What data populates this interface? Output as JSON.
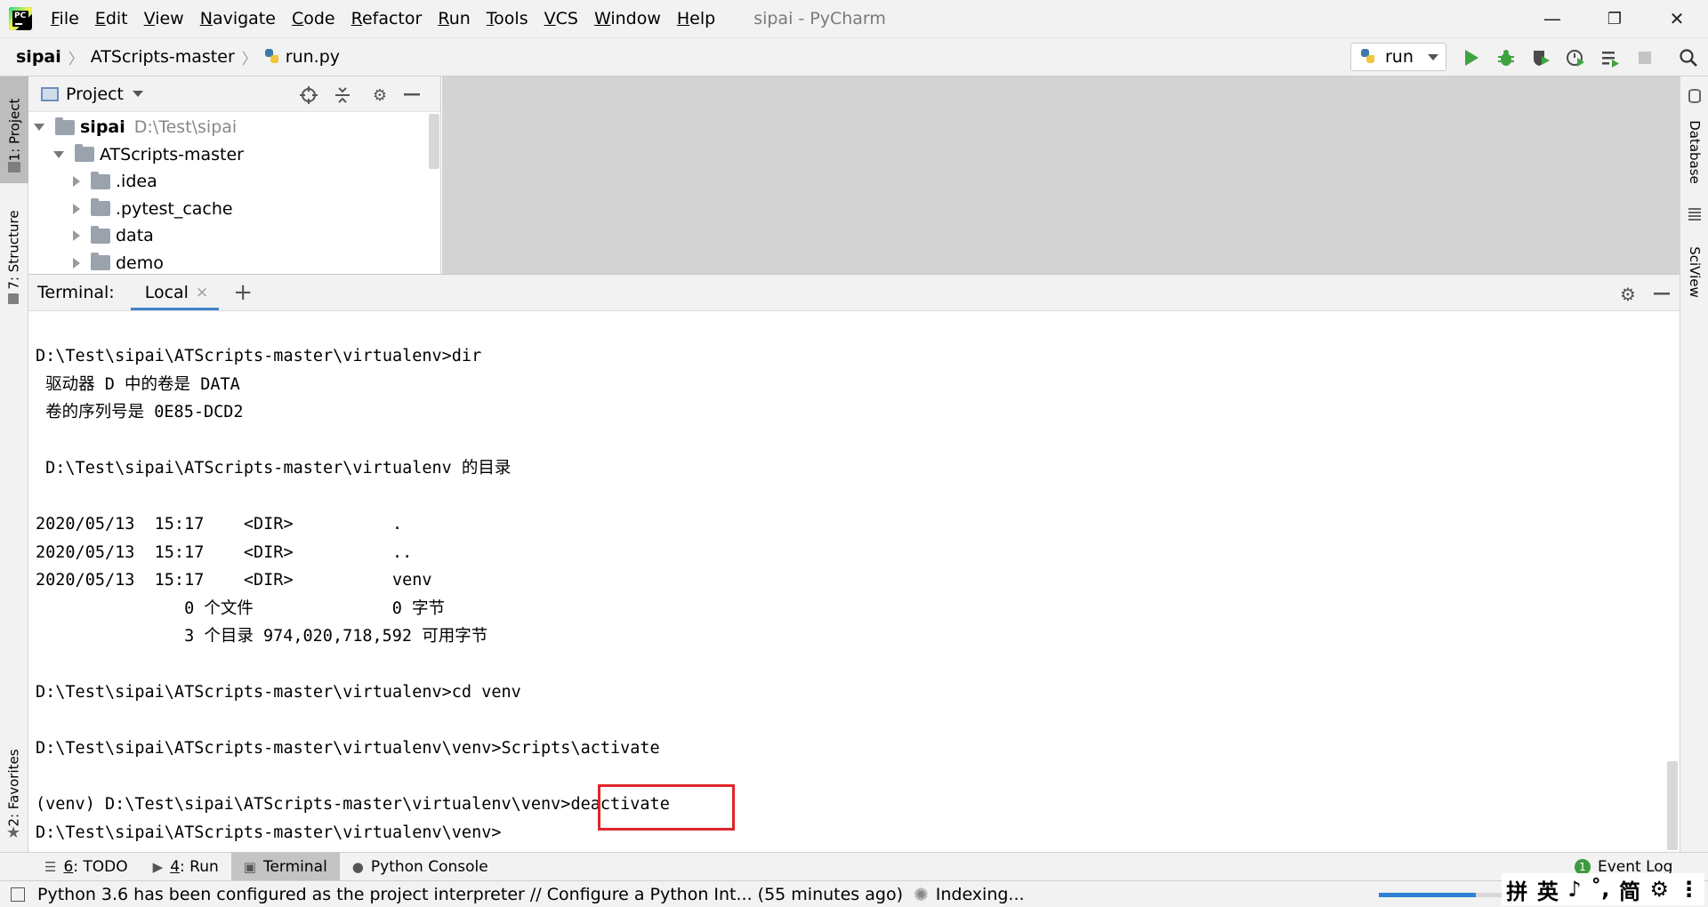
{
  "window": {
    "title": "sipai - PyCharm",
    "minimize_glyph": "—",
    "restore_glyph": "❐",
    "close_glyph": "✕"
  },
  "menu": [
    {
      "label": "File",
      "ul": "F",
      "rest": "ile"
    },
    {
      "label": "Edit",
      "ul": "E",
      "rest": "dit"
    },
    {
      "label": "View",
      "ul": "V",
      "rest": "iew"
    },
    {
      "label": "Navigate",
      "ul": "N",
      "rest": "avigate"
    },
    {
      "label": "Code",
      "ul": "C",
      "rest": "ode"
    },
    {
      "label": "Refactor",
      "ul": "R",
      "rest": "efactor"
    },
    {
      "label": "Run",
      "ul": "R",
      "rest": "un"
    },
    {
      "label": "Tools",
      "ul": "T",
      "rest": "ools"
    },
    {
      "label": "VCS",
      "ul": "V",
      "rest": "CS"
    },
    {
      "label": "Window",
      "ul": "W",
      "rest": "indow"
    },
    {
      "label": "Help",
      "ul": "H",
      "rest": "elp"
    }
  ],
  "logo": {
    "text": "PC"
  },
  "breadcrumb": {
    "root": "sipai",
    "folder": "ATScripts-master",
    "file": "run.py",
    "separator": "〉"
  },
  "toolbar": {
    "run_config": "run",
    "icons": [
      "run-icon",
      "debug-icon",
      "coverage-icon",
      "profile-icon",
      "concurrency-icon",
      "stop-icon",
      "search-icon"
    ]
  },
  "left_stripe": {
    "project_tab": "1: Project",
    "structure_tab": "7: Structure",
    "favorites_tab": "2: Favorites"
  },
  "right_stripe": {
    "database_tab": "Database",
    "sciview_tab": "SciView"
  },
  "project_panel": {
    "title": "Project",
    "tree": [
      {
        "name": "sipai",
        "path": "D:\\Test\\sipai",
        "expanded": true
      },
      {
        "name": "ATScripts-master",
        "expanded": true
      },
      {
        "name": ".idea",
        "expanded": false
      },
      {
        "name": ".pytest_cache",
        "expanded": false
      },
      {
        "name": "data",
        "expanded": false
      },
      {
        "name": "demo",
        "expanded": false
      }
    ]
  },
  "terminal": {
    "label": "Terminal:",
    "tab": "Local",
    "close_glyph": "×",
    "new_tab_glyph": "+",
    "lines": [
      "D:\\Test\\sipai\\ATScripts-master\\virtualenv>dir",
      " 驱动器 D 中的卷是 DATA",
      " 卷的序列号是 0E85-DCD2",
      "",
      " D:\\Test\\sipai\\ATScripts-master\\virtualenv 的目录",
      "",
      "2020/05/13  15:17    <DIR>          .",
      "2020/05/13  15:17    <DIR>          ..",
      "2020/05/13  15:17    <DIR>          venv",
      "               0 个文件              0 字节",
      "               3 个目录 974,020,718,592 可用字节",
      "",
      "D:\\Test\\sipai\\ATScripts-master\\virtualenv>cd venv",
      "",
      "D:\\Test\\sipai\\ATScripts-master\\virtualenv\\venv>Scripts\\activate",
      "",
      "(venv) D:\\Test\\sipai\\ATScripts-master\\virtualenv\\venv>deactivate",
      "D:\\Test\\sipai\\ATScripts-master\\virtualenv\\venv>"
    ]
  },
  "bottom_tabs": [
    {
      "num": "6",
      "label": ": TODO",
      "icon": "todo-icon",
      "glyph": "☰"
    },
    {
      "num": "4",
      "label": ": Run",
      "icon": "run-tab-icon",
      "glyph": "▶"
    },
    {
      "num": "",
      "label": "Terminal",
      "icon": "terminal-icon",
      "glyph": "▣"
    },
    {
      "num": "",
      "label": "Python Console",
      "icon": "python-console-icon",
      "glyph": "●"
    }
  ],
  "event_log": {
    "label": "Event Log",
    "count": "1"
  },
  "status": {
    "message": "Python 3.6 has been configured as the project interpreter // Configure a Python Int... (55 minutes ago)",
    "indexing": "Indexing...",
    "progress": 0.78
  },
  "ime": [
    "拼",
    "英",
    "♪",
    "˚,",
    "简",
    "⚙",
    "⋮"
  ]
}
